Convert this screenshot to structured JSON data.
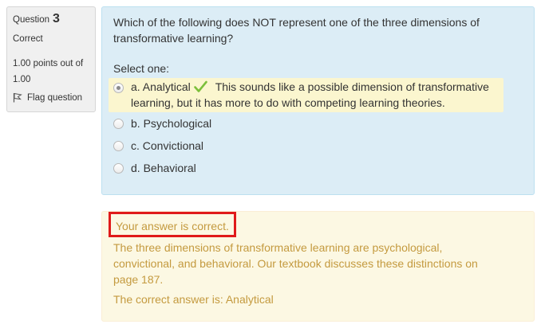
{
  "info": {
    "question_label": "Question",
    "question_number": "3",
    "state": "Correct",
    "grade": "1.00 points out of 1.00",
    "flag_label": "Flag question"
  },
  "question": {
    "text": "Which of the following does NOT represent one of the three dimensions of transformative learning?",
    "prompt": "Select one:",
    "options": [
      {
        "label": "a. Analytical",
        "selected": true,
        "correct": true
      },
      {
        "label": "b. Psychological",
        "selected": false
      },
      {
        "label": "c. Convictional",
        "selected": false
      },
      {
        "label": "d. Behavioral",
        "selected": false
      }
    ],
    "specific_feedback": "This sounds like a possible dimension of transformative learning, but it has more to do with competing learning theories."
  },
  "feedback": {
    "result": "Your answer is correct.",
    "general": "The three dimensions of transformative learning are psychological, convictional, and behavioral.  Our textbook discusses these distinctions on page 187.",
    "correct_answer": "The correct answer is: Analytical"
  },
  "colors": {
    "formulation_bg": "#dcedf6",
    "outcome_bg": "#fcf8e3",
    "outcome_text": "#c49a3f",
    "highlight_bg": "#fbf6cf",
    "check_green": "#7bbf3a",
    "annotation_red": "#e01a1a"
  },
  "icons": {
    "flag": "flag-icon",
    "correct": "checkmark-icon"
  }
}
